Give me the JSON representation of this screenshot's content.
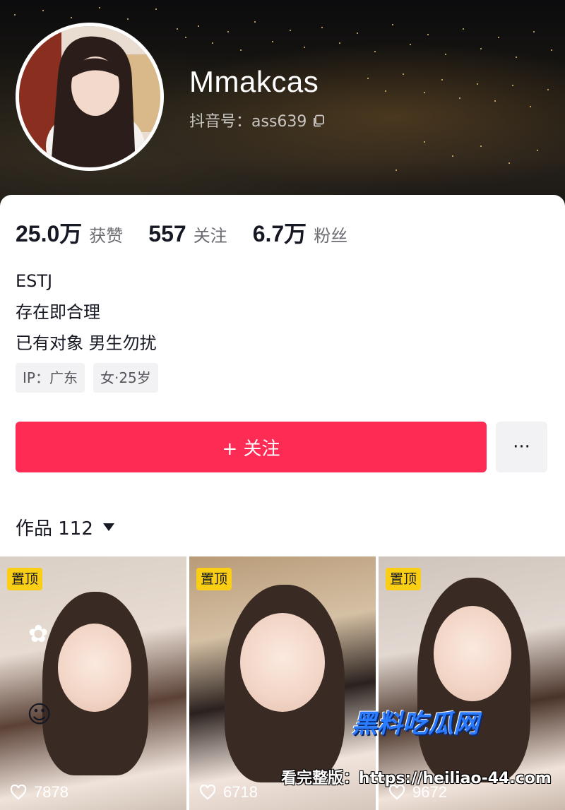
{
  "profile": {
    "username": "Mmakcas",
    "douyin_id": "抖音号：ass639",
    "avatar_icon": "avatar"
  },
  "stats": [
    {
      "value": "25.0万",
      "label": "获赞"
    },
    {
      "value": "557",
      "label": "关注"
    },
    {
      "value": "6.7万",
      "label": "粉丝"
    }
  ],
  "bio": {
    "line1": "ESTJ",
    "line2": "存在即合理",
    "line3": "已有对象 男生勿扰"
  },
  "tags": {
    "ip": "IP：广东",
    "gender_age": "女·25岁"
  },
  "actions": {
    "follow_label": "+ 关注",
    "more_label": "···"
  },
  "works": {
    "label": "作品 112"
  },
  "thumbnails": [
    {
      "pin": "置顶",
      "likes": "7878"
    },
    {
      "pin": "置顶",
      "likes": "6718"
    },
    {
      "pin": "置顶",
      "likes": "9672"
    }
  ],
  "watermark": {
    "title": "黑料吃瓜网",
    "url": "看完整版：https://heiliao-44.com"
  },
  "colors": {
    "accent": "#fe2c55",
    "pin_badge": "#face15"
  }
}
